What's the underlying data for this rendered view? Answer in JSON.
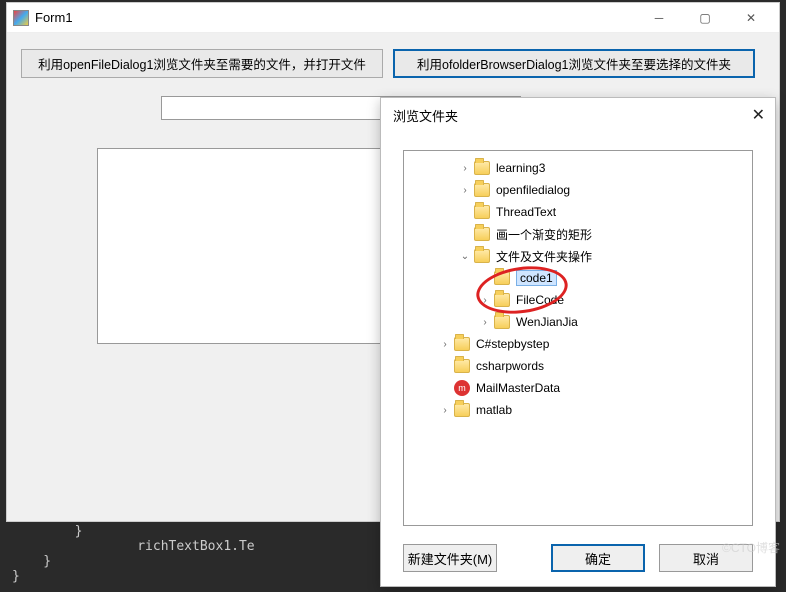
{
  "form": {
    "title": "Form1",
    "btn1": "利用openFileDialog1浏览文件夹至需要的文件，并打开文件",
    "btn2": "利用ofolderBrowserDialog1浏览文件夹至要选择的文件夹"
  },
  "dialog": {
    "title": "浏览文件夹",
    "newfolder": "新建文件夹(M)",
    "ok": "确定",
    "cancel": "取消"
  },
  "tree": [
    {
      "indent": 2,
      "twisty": ">",
      "icon": "folder",
      "label": "learning3"
    },
    {
      "indent": 2,
      "twisty": ">",
      "icon": "folder",
      "label": "openfiledialog"
    },
    {
      "indent": 2,
      "twisty": "",
      "icon": "folder",
      "label": "ThreadText"
    },
    {
      "indent": 2,
      "twisty": "",
      "icon": "folder",
      "label": "画一个渐变的矩形"
    },
    {
      "indent": 2,
      "twisty": "v",
      "icon": "folder",
      "label": "文件及文件夹操作"
    },
    {
      "indent": 3,
      "twisty": "",
      "icon": "folder",
      "label": "code1",
      "selected": true
    },
    {
      "indent": 3,
      "twisty": ">",
      "icon": "folder",
      "label": "FileCode"
    },
    {
      "indent": 3,
      "twisty": ">",
      "icon": "folder",
      "label": "WenJianJia"
    },
    {
      "indent": 1,
      "twisty": ">",
      "icon": "folder",
      "label": "C#stepbystep"
    },
    {
      "indent": 1,
      "twisty": "",
      "icon": "folder",
      "label": "csharpwords"
    },
    {
      "indent": 1,
      "twisty": "",
      "icon": "red",
      "label": "MailMasterData"
    },
    {
      "indent": 1,
      "twisty": ">",
      "icon": "folder",
      "label": "matlab"
    }
  ],
  "twisty_glyph": {
    ">": "›",
    "v": "⌄",
    "": ""
  },
  "code_bg": "        }\n                richTextBox1.Te\n    }\n}",
  "watermark": "©CTO博客"
}
